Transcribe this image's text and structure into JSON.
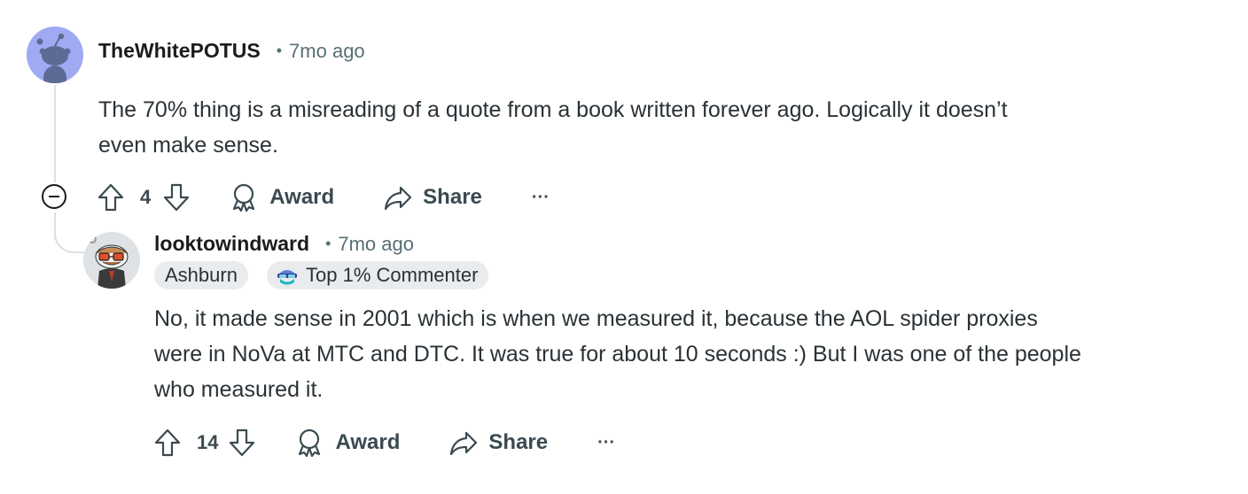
{
  "comments": [
    {
      "author": "TheWhitePOTUS",
      "separator": "•",
      "time": "7mo ago",
      "body_line1": "The 70% thing is a misreading of a quote from a book written forever ago. Logically it doesn’t",
      "body_line2": "even make sense.",
      "votes": "4",
      "award_label": "Award",
      "share_label": "Share",
      "more_label": "···",
      "avatar_color": "#9faaf3"
    },
    {
      "author": "looktowindward",
      "separator": "•",
      "time": "7mo ago",
      "flair_location": "Ashburn",
      "flair_commenter": "Top 1% Commenter",
      "body_line1": "No, it made sense in 2001 which is when we measured it, because the AOL spider proxies",
      "body_line2": "were in NoVa at MTC and DTC. It was true for about 10 seconds :) But I was one of the people",
      "body_line3": "who measured it.",
      "votes": "14",
      "award_label": "Award",
      "share_label": "Share",
      "more_label": "···"
    }
  ],
  "icons": {
    "upvote": "upvote-arrow-icon",
    "downvote": "downvote-arrow-icon",
    "award": "award-ribbon-icon",
    "share": "share-arrow-icon",
    "collapse": "collapse-minus-icon",
    "more": "more-dots-icon"
  },
  "colors": {
    "thread_line": "#dcdfe2",
    "meta_text": "#576f76",
    "flair_bg": "#e9ebed"
  }
}
